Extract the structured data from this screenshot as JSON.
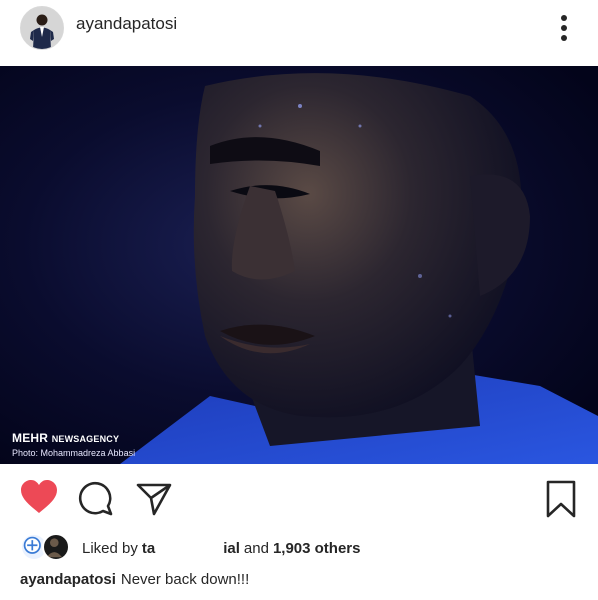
{
  "post": {
    "username": "ayandapatosi",
    "photo_alt": "Portrait of a football player",
    "watermark": {
      "brand": "MEHR",
      "brand_sub": "NEWSAGENCY",
      "credit": "Photo: Mohammadreza Abbasi"
    },
    "likes": {
      "prefix": "Liked by",
      "first_liker_partial": "ta",
      "second_liker_partial": "ial",
      "and_label": "and",
      "others_count": "1,903 others"
    },
    "caption": {
      "username": "ayandapatosi",
      "text": "Never back down!!!"
    },
    "liked": true
  },
  "colors": {
    "heart": "#ed4956",
    "text": "#262626",
    "photo_bg": "#05061a"
  },
  "icons": [
    "more-options-icon",
    "heart-icon",
    "comment-icon",
    "share-icon",
    "bookmark-icon"
  ]
}
